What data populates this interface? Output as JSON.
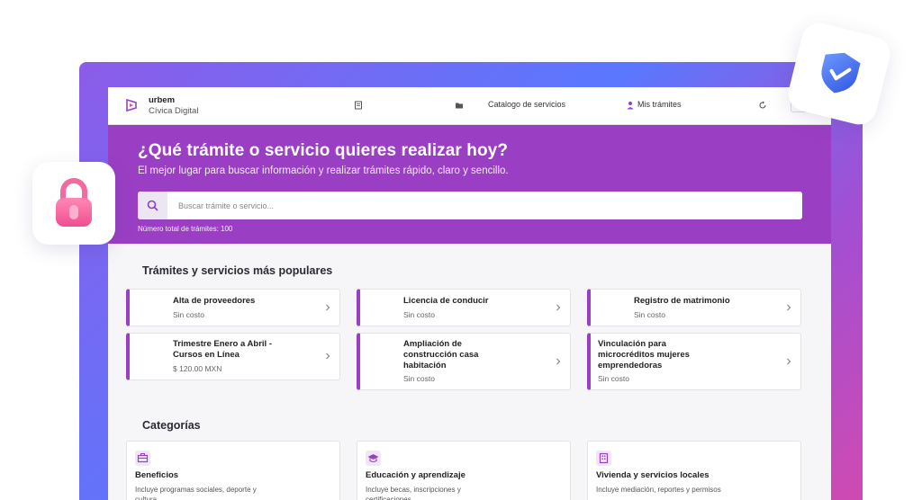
{
  "brand": {
    "name": "urbem",
    "subtitle": "Cívica Digital"
  },
  "nav": {
    "catalog_label": "Catalogo de servicios",
    "my_procedures_label": "Mis trámites"
  },
  "hero": {
    "title": "¿Qué trámite o servicio quieres realizar hoy?",
    "subtitle": "El mejor lugar para buscar información y realizar trámites rápido, claro y sencillo.",
    "search_placeholder": "Buscar trámite o servicio...",
    "total_label": "Número total de trámites: 100"
  },
  "popular": {
    "title": "Trámites y servicios más populares",
    "items": [
      {
        "title": "Alta de proveedores",
        "price": "Sin costo"
      },
      {
        "title": "Licencia de conducir",
        "price": "Sin costo"
      },
      {
        "title": "Registro de matrimonio",
        "price": "Sin costo"
      },
      {
        "title": "Trimestre Enero a Abril - Cursos en Línea",
        "price": "$ 120.00 MXN"
      },
      {
        "title": "Ampliación de construcción casa habitación",
        "price": "Sin costo"
      },
      {
        "title": "Vinculación para microcréditos mujeres emprendedoras",
        "price": "Sin costo"
      }
    ]
  },
  "categories": {
    "title": "Categorías",
    "items": [
      {
        "title": "Beneficios",
        "desc": "Incluye programas sociales, deporte y cultura",
        "icon": "briefcase-icon"
      },
      {
        "title": "Educación y aprendizaje",
        "desc": "Incluye becas, inscripciones y certificaciones",
        "icon": "graduation-cap-icon"
      },
      {
        "title": "Vivienda y servicios locales",
        "desc": "Incluye mediación, reportes y permisos",
        "icon": "building-icon"
      }
    ]
  },
  "colors": {
    "accent": "#9a3fc4",
    "hero_bg": "#9a3fc4",
    "lock": "#f0558f",
    "shield": "#3f6ef0"
  }
}
